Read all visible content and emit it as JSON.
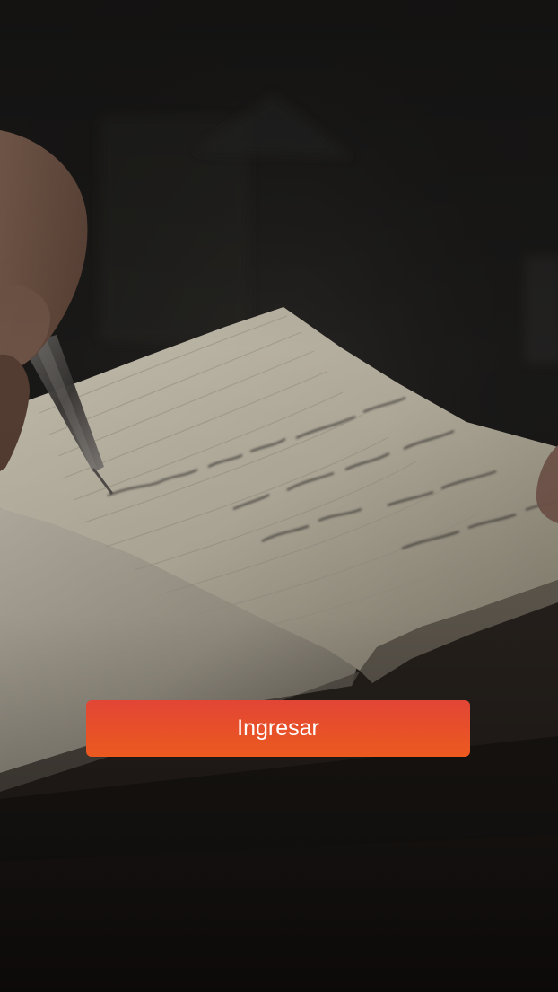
{
  "screen": {
    "background_image": "photo-hand-writing-in-notebook"
  },
  "actions": {
    "login_label": "Ingresar",
    "login_colors": {
      "top": "#e24535",
      "bottom": "#ec5a1f",
      "text": "#ffffff"
    }
  }
}
